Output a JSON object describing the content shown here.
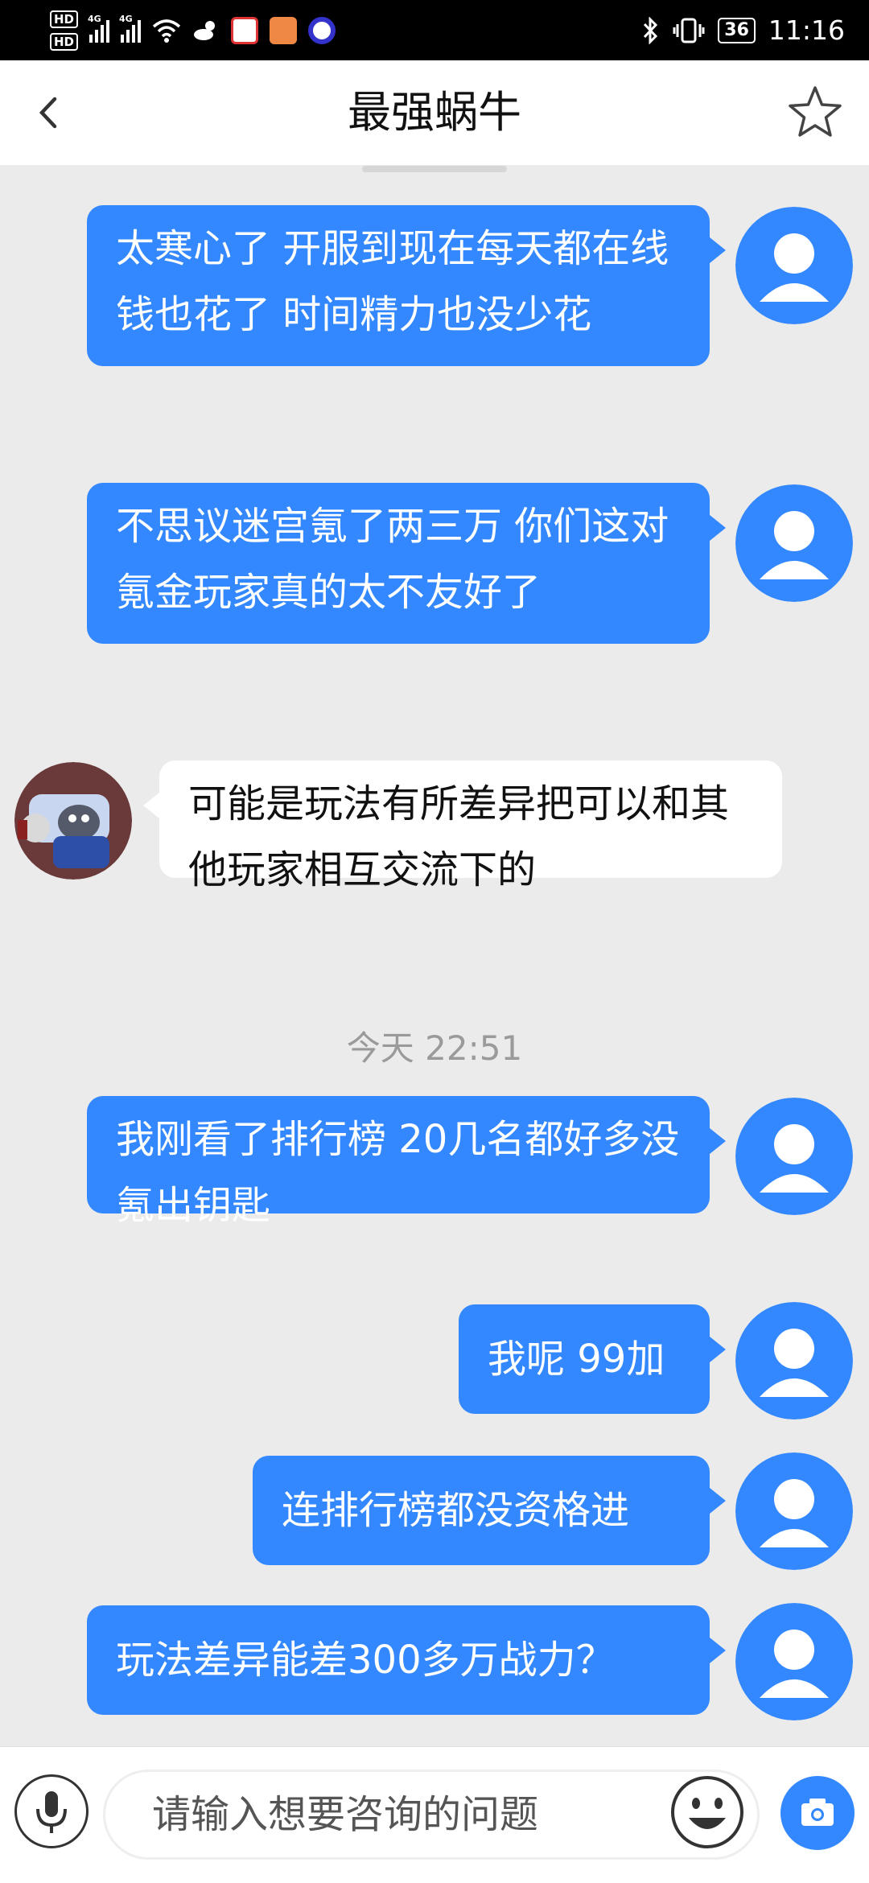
{
  "status_bar": {
    "network_labels": [
      "HD",
      "HD",
      "4G",
      "4G"
    ],
    "battery": "36",
    "time": "11:16"
  },
  "header": {
    "title": "最强蜗牛",
    "back_icon": "chevron-left-icon",
    "favorite_icon": "star-outline-icon"
  },
  "messages": [
    {
      "sender": "me",
      "text": "太寒心了 开服到现在每天都在线 钱也花了 时间精力也没少花"
    },
    {
      "sender": "me",
      "text": "不思议迷宫氪了两三万 你们这对氪金玩家真的太不友好了"
    },
    {
      "sender": "support",
      "text": "可能是玩法有所差异把可以和其他玩家相互交流下的"
    },
    {
      "sender": "me",
      "text": "我刚看了排行榜 20几名都好多没氪出钥匙"
    },
    {
      "sender": "me",
      "text": "我呢 99加"
    },
    {
      "sender": "me",
      "text": "连排行榜都没资格进"
    },
    {
      "sender": "me",
      "text": "玩法差异能差300多万战力？"
    }
  ],
  "timestamps": {
    "today": "今天 22:51"
  },
  "input_bar": {
    "placeholder": "请输入想要咨询的问题",
    "icons": [
      "microphone-icon",
      "emoji-icon",
      "camera-icon"
    ]
  },
  "colors": {
    "accent": "#3388ff",
    "background": "#ebebeb",
    "status_bar": "#000000"
  }
}
